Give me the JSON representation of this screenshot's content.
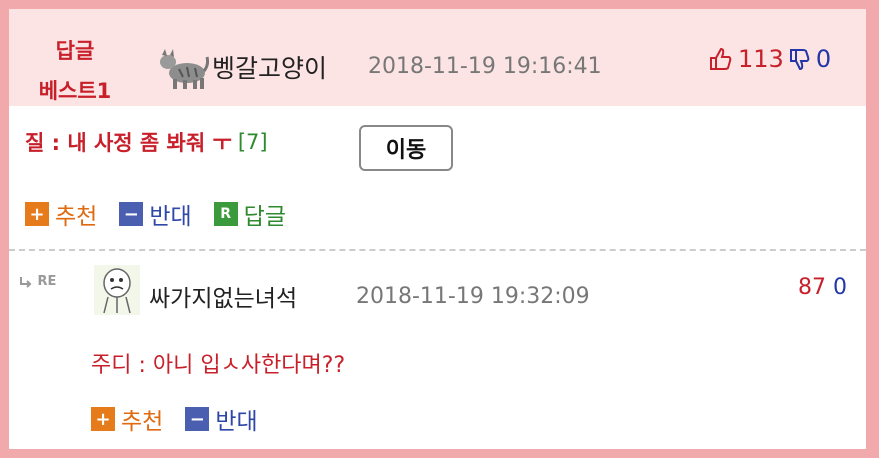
{
  "best": {
    "label_line1": "답글",
    "label_line2": "베스트1",
    "nickname": "벵갈고양이",
    "datetime": "2018-11-19 19:16:41",
    "up": "113",
    "down": "0"
  },
  "post": {
    "title": "질 : 내 사정 좀 봐줘 ㅜ",
    "comment_count": "[7]",
    "move_label": "이동"
  },
  "actions": {
    "recommend": "추천",
    "oppose": "반대",
    "reply": "답글",
    "plus_glyph": "+",
    "minus_glyph": "−",
    "reply_glyph": "R"
  },
  "reply": {
    "tag": "RE",
    "nickname": "싸가지없는녀석",
    "datetime": "2018-11-19 19:32:09",
    "up": "87",
    "down": "0",
    "text": "주디 : 아니 입ㅅ사한다며??"
  },
  "colors": {
    "accent_red": "#c8202a",
    "down_blue": "#2236a8",
    "frame_pink": "#f2a9ab"
  }
}
